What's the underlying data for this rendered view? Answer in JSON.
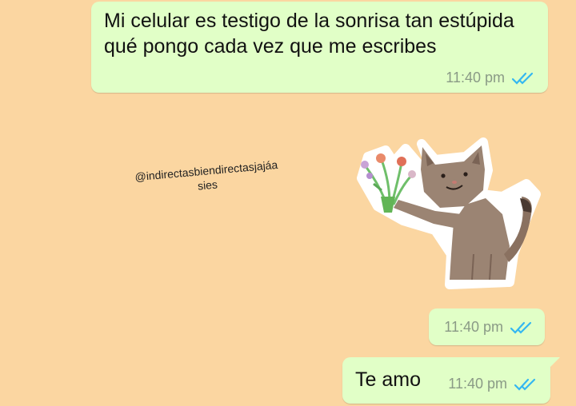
{
  "messages": [
    {
      "text": "Mi celular es testigo de la sonrisa tan estúpida qué pongo cada vez que me escribes",
      "time": "11:40 pm",
      "status": "read"
    },
    {
      "type": "sticker",
      "sticker": "cat-holding-flowers",
      "time": "11:40 pm",
      "status": "read"
    },
    {
      "text": "Te amo",
      "time": "11:40 pm",
      "status": "read"
    }
  ],
  "watermark": {
    "line1": "@indirectasbiendirectasjajáa",
    "line2": "sies"
  },
  "colors": {
    "background": "#fbd6a1",
    "bubble": "#e1ffc7",
    "read_ticks": "#34b7f1",
    "timestamp": "#8a9a86"
  }
}
